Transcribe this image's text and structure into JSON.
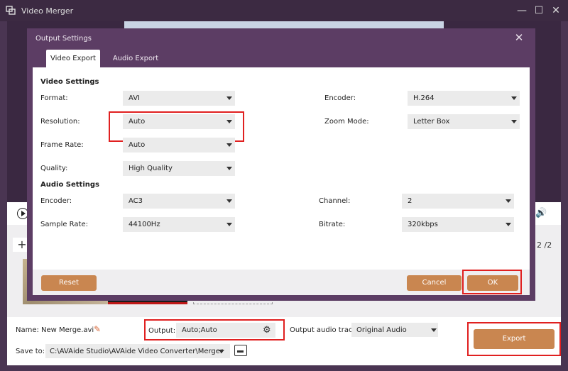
{
  "window": {
    "title": "Video Merger",
    "minimize_glyph": "—",
    "maximize_glyph": "☐",
    "close_glyph": "✕"
  },
  "player": {
    "page_counter": "2 /2",
    "add_glyph": "+",
    "volume_glyph": "🔊"
  },
  "bottom": {
    "name_label": "Name:",
    "name_value": "New Merge.avi",
    "output_label": "Output:",
    "output_value": "Auto;Auto",
    "audio_track_label": "Output audio track:",
    "audio_track_value": "Original Audio",
    "saveto_label": "Save to:",
    "saveto_value": "C:\\AVAide Studio\\AVAide Video Converter\\Merger",
    "export_label": "Export",
    "edit_glyph": "✎",
    "gear_glyph": "⚙"
  },
  "dialog": {
    "title": "Output Settings",
    "close_glyph": "✕",
    "tabs": [
      {
        "label": "Video Export",
        "active": true
      },
      {
        "label": "Audio Export",
        "active": false
      }
    ],
    "video_settings": {
      "title": "Video Settings",
      "format": {
        "label": "Format:",
        "value": "AVI"
      },
      "encoder": {
        "label": "Encoder:",
        "value": "H.264"
      },
      "resolution": {
        "label": "Resolution:",
        "value": "Auto"
      },
      "zoom_mode": {
        "label": "Zoom Mode:",
        "value": "Letter Box"
      },
      "frame_rate": {
        "label": "Frame Rate:",
        "value": "Auto"
      },
      "quality": {
        "label": "Quality:",
        "value": "High Quality"
      }
    },
    "audio_settings": {
      "title": "Audio Settings",
      "encoder": {
        "label": "Encoder:",
        "value": "AC3"
      },
      "channel": {
        "label": "Channel:",
        "value": "2"
      },
      "sample_rate": {
        "label": "Sample Rate:",
        "value": "44100Hz"
      },
      "bitrate": {
        "label": "Bitrate:",
        "value": "320kbps"
      }
    },
    "buttons": {
      "reset": "Reset",
      "cancel": "Cancel",
      "ok": "OK"
    }
  },
  "colors": {
    "accent": "#c98650",
    "highlight_border": "#e02020",
    "dialog_bg": "#5c3d64",
    "titlebar_bg": "#3c2a42"
  }
}
